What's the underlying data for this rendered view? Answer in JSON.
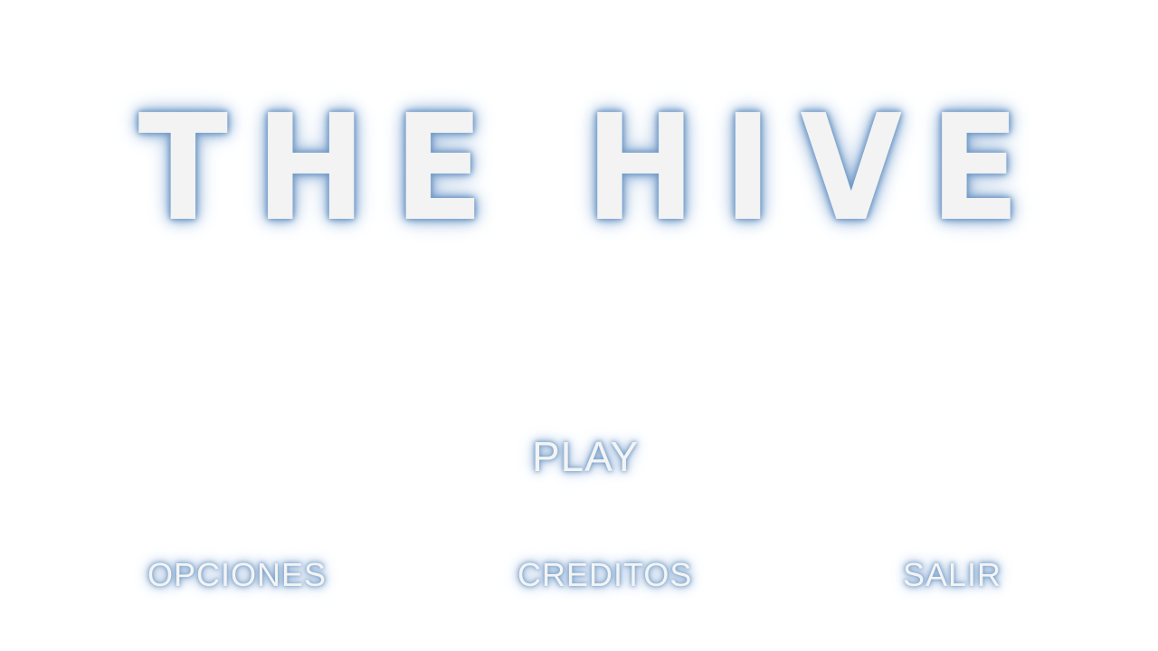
{
  "title": "THE HIVE",
  "menu": {
    "play": "PLAY",
    "options": "OPCIONES",
    "credits": "CREDITOS",
    "exit": "SALIR"
  },
  "colors": {
    "background": "#ffffff",
    "text": "#f3f3f3",
    "glow": "#6d97c4"
  }
}
